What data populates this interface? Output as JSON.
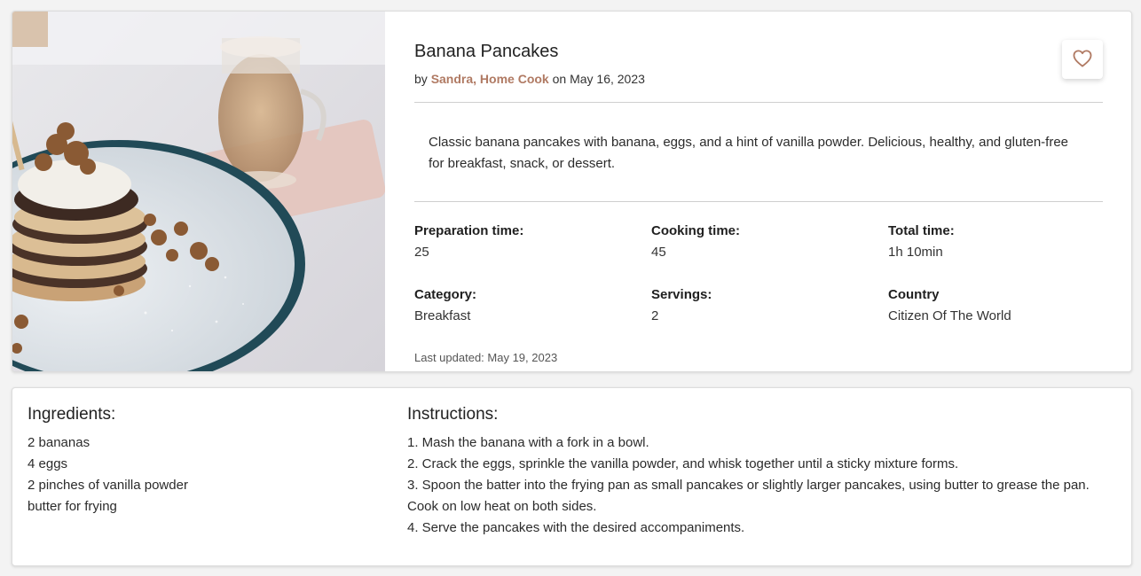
{
  "recipe": {
    "title": "Banana Pancakes",
    "by_prefix": "by",
    "author": "Sandra, Home Cook",
    "date_prefix": "on",
    "date": "May 16, 2023",
    "favorite_icon": "heart-outline-icon",
    "description": "Classic banana pancakes with banana, eggs, and a hint of vanilla powder. Delicious, healthy, and gluten-free for breakfast, snack, or dessert.",
    "meta": {
      "prep_label": "Preparation time:",
      "prep_value": "25",
      "cook_label": "Cooking time:",
      "cook_value": "45",
      "total_label": "Total time:",
      "total_value": "1h 10min",
      "category_label": "Category:",
      "category_value": "Breakfast",
      "servings_label": "Servings:",
      "servings_value": "2",
      "country_label": "Country",
      "country_value": "Citizen Of The World"
    },
    "last_updated": "Last updated: May 19, 2023"
  },
  "ingredients": {
    "heading": "Ingredients:",
    "items": [
      "2 bananas",
      "4 eggs",
      "2 pinches of vanilla powder",
      "butter for frying"
    ]
  },
  "instructions": {
    "heading": "Instructions:",
    "steps": [
      "1. Mash the banana with a fork in a bowl.",
      "2. Crack the eggs, sprinkle the vanilla powder, and whisk together until a sticky mixture forms.",
      "3. Spoon the batter into the frying pan as small pancakes or slightly larger pancakes, using butter to grease the pan. Cook on low heat on both sides.",
      "4. Serve the pancakes with the desired accompaniments."
    ]
  },
  "colors": {
    "accent": "#b07a63",
    "heart": "#b07a63"
  }
}
